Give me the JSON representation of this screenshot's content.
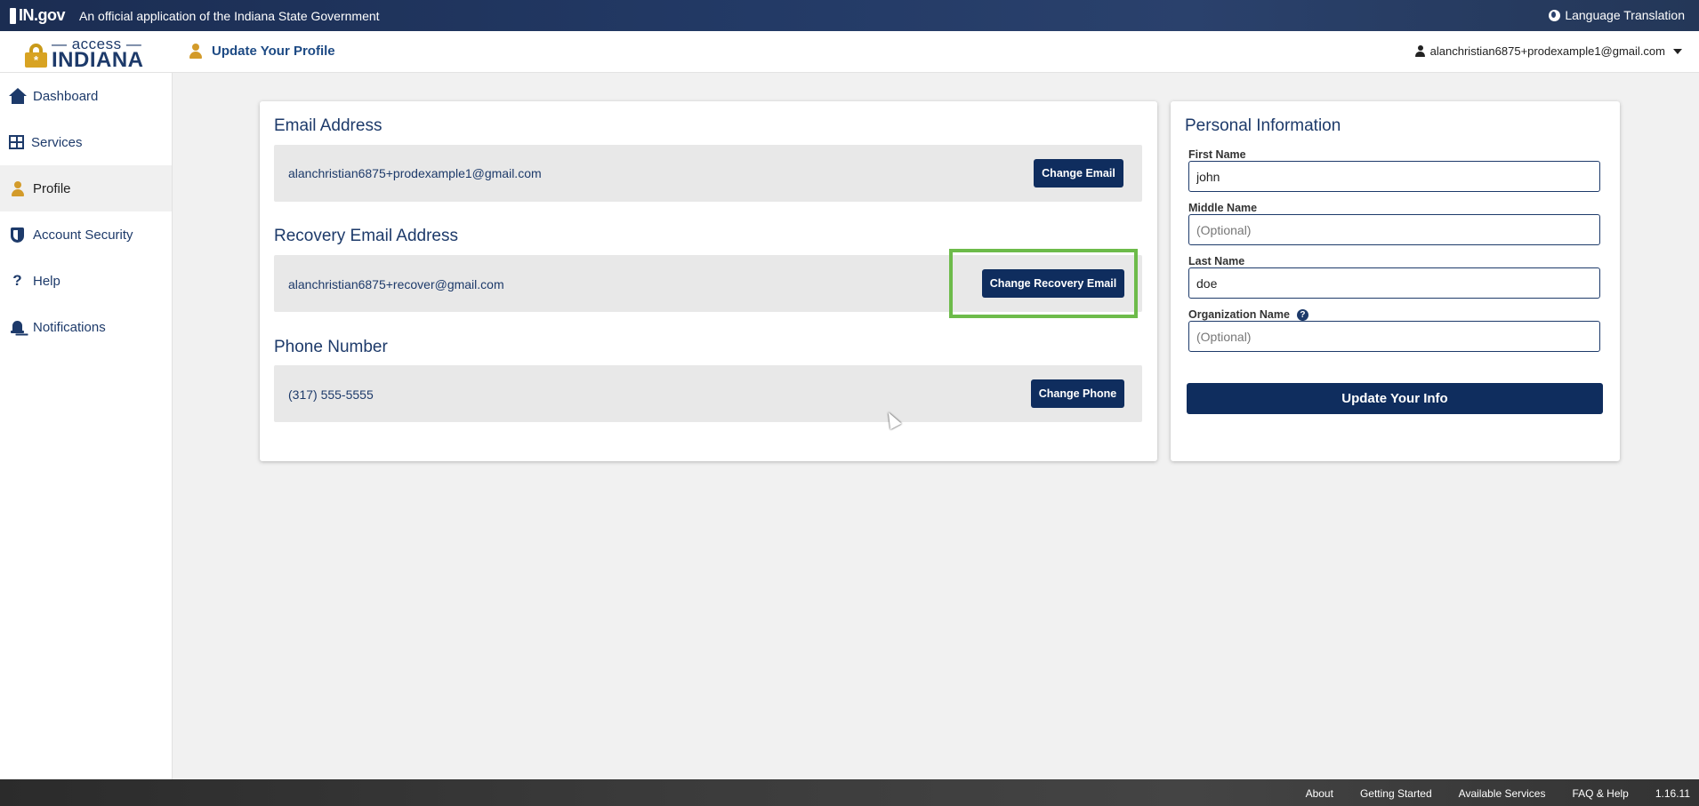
{
  "topbar": {
    "ingov_label": "IN.gov",
    "official_text": "An official application of the Indiana State Government",
    "language_label": "Language Translation",
    "language_icon": "globe-icon"
  },
  "header": {
    "logo_access": "— access —",
    "logo_indiana": "INDIANA",
    "logo_lock_glyph": "*",
    "page_title": "Update Your Profile",
    "user_email": "alanchristian6875+prodexample1@gmail.com"
  },
  "sidebar": {
    "items": [
      {
        "label": "Dashboard",
        "icon": "home-icon"
      },
      {
        "label": "Services",
        "icon": "grid-icon"
      },
      {
        "label": "Profile",
        "icon": "person-icon",
        "active": true
      },
      {
        "label": "Account Security",
        "icon": "shield-icon"
      },
      {
        "label": "Help",
        "icon": "question-icon"
      },
      {
        "label": "Notifications",
        "icon": "bell-icon"
      }
    ]
  },
  "contact": {
    "email": {
      "title": "Email Address",
      "value": "alanchristian6875+prodexample1@gmail.com",
      "button": "Change Email"
    },
    "recovery": {
      "title": "Recovery Email Address",
      "value": "alanchristian6875+recover@gmail.com",
      "button": "Change Recovery Email"
    },
    "phone": {
      "title": "Phone Number",
      "value": "(317) 555-5555",
      "button": "Change Phone"
    }
  },
  "personal": {
    "title": "Personal Information",
    "first_name": {
      "label": "First Name",
      "value": "john",
      "placeholder": ""
    },
    "middle_name": {
      "label": "Middle Name",
      "value": "",
      "placeholder": "(Optional)"
    },
    "last_name": {
      "label": "Last Name",
      "value": "doe",
      "placeholder": ""
    },
    "organization": {
      "label": "Organization Name",
      "value": "",
      "placeholder": "(Optional)",
      "help_glyph": "?"
    },
    "submit": "Update Your Info"
  },
  "footer": {
    "links": [
      "About",
      "Getting Started",
      "Available Services",
      "FAQ & Help"
    ],
    "version": "1.16.11"
  },
  "colors": {
    "primary": "#0f2d5e",
    "accent_gold": "#d39b2a",
    "highlight_green": "#6dbb4a"
  }
}
